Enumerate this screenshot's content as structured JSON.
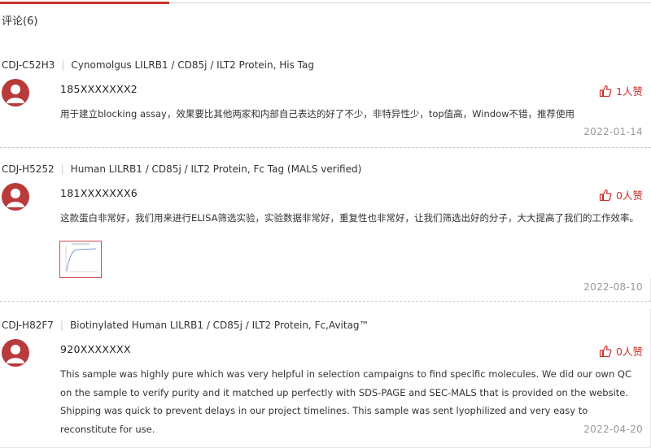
{
  "section": {
    "heading": "评论(6)"
  },
  "reviews": [
    {
      "sku": "CDJ-C52H3",
      "product": "Cynomolgus LILRB1 / CD85j / ILT2 Protein, His Tag",
      "user": "185XXXXXXX2",
      "likes": "1人赞",
      "text": "用于建立blocking assay，效果要比其他两家和内部自己表达的好了不少，非特异性少，top值高，Window不错，推荐使用",
      "date": "2022-01-14"
    },
    {
      "sku": "CDJ-H5252",
      "product": "Human LILRB1 / CD85j / ILT2 Protein, Fc Tag (MALS verified)",
      "user": "181XXXXXXX6",
      "likes": "0人赞",
      "text": "这款蛋白非常好，我们用来进行ELISA筛选实验，实验数据非常好，重复性也非常好，让我们筛选出好的分子，大大提高了我们的工作效率。",
      "date": "2022-08-10"
    },
    {
      "sku": "CDJ-H82F7",
      "product": "Biotinylated Human LILRB1 / CD85j / ILT2 Protein, Fc,Avitag™",
      "user": "920XXXXXXX",
      "likes": "0人赞",
      "text": "This sample was highly pure which was very helpful in selection campaigns to find specific molecules. We did our own QC on the sample to verify purity and it matched up perfectly with SDS-PAGE and SEC-MALS that is provided on the website. Shipping was quick to prevent delays in our project timelines. This sample was sent lyophilized and very easy to reconstitute for use.",
      "date": "2022-04-20"
    }
  ],
  "colors": {
    "accent": "#c9302c",
    "avatar": "#b83a3a",
    "muted": "#999999"
  },
  "icons": {
    "avatar": "user-avatar-icon",
    "like": "thumbs-up-icon"
  }
}
